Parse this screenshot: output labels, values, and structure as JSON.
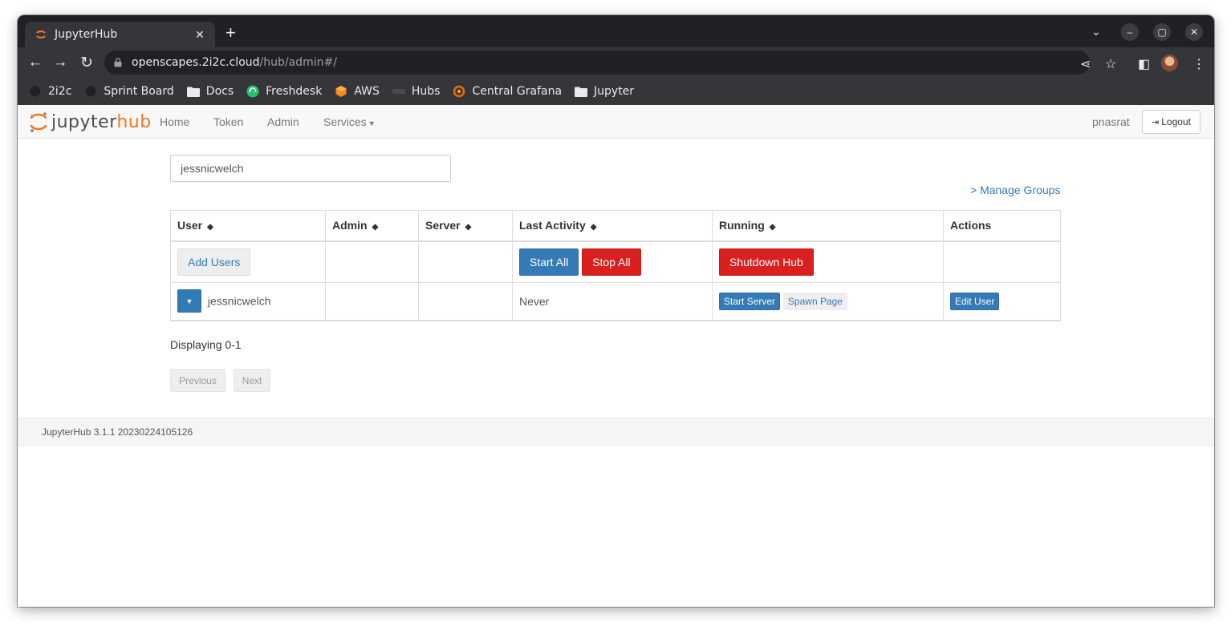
{
  "browser": {
    "tab_title": "JupyterHub",
    "tab_close": "✕",
    "new_tab": "+",
    "url_host": "openscapes.2i2c.cloud",
    "url_path": "/hub/admin#/",
    "bookmarks": [
      {
        "label": "2i2c",
        "icon": "github-icon"
      },
      {
        "label": "Sprint Board",
        "icon": "github-icon"
      },
      {
        "label": "Docs",
        "icon": "folder-icon"
      },
      {
        "label": "Freshdesk",
        "icon": "headset-icon"
      },
      {
        "label": "AWS",
        "icon": "aws-cube-icon"
      },
      {
        "label": "Hubs",
        "icon": "2i2c-logo-icon"
      },
      {
        "label": "Central Grafana",
        "icon": "grafana-icon"
      },
      {
        "label": "Jupyter",
        "icon": "folder-icon"
      }
    ]
  },
  "navbar": {
    "logo_prefix": "jupyter",
    "logo_suffix": "hub",
    "links": [
      "Home",
      "Token",
      "Admin",
      "Services"
    ],
    "username": "pnasrat",
    "logout_label": "Logout"
  },
  "search": {
    "value": "jessnicwelch"
  },
  "manage_groups": "> Manage Groups",
  "table": {
    "headers": [
      "User",
      "Admin",
      "Server",
      "Last Activity",
      "Running",
      "Actions"
    ],
    "controls": {
      "add_users": "Add Users",
      "start_all": "Start All",
      "stop_all": "Stop All",
      "shutdown_hub": "Shutdown Hub"
    },
    "rows": [
      {
        "user": "jessnicwelch",
        "admin": "",
        "server": "",
        "last_activity": "Never",
        "start_server": "Start Server",
        "spawn_page": "Spawn Page",
        "edit_user": "Edit User"
      }
    ]
  },
  "displaying": "Displaying 0-1",
  "pagination": {
    "previous": "Previous",
    "next": "Next"
  },
  "footer": "JupyterHub 3.1.1 20230224105126",
  "colors": {
    "primary": "#337ab7",
    "danger": "#d9201f",
    "brand_orange": "#f37726"
  }
}
